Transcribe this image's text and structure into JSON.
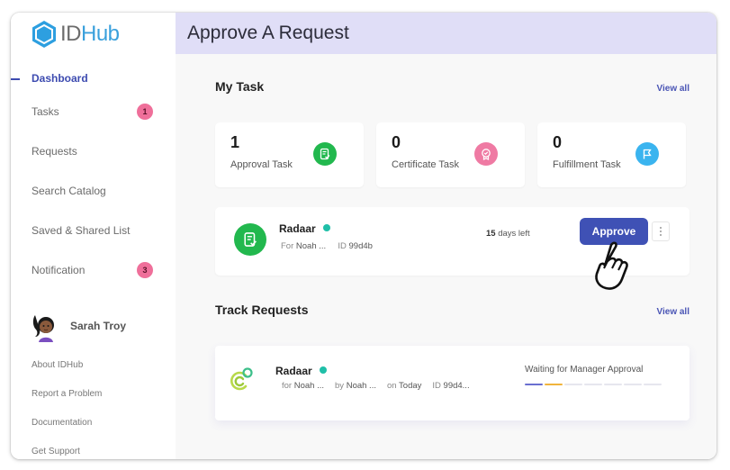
{
  "app": {
    "logo_prefix": "ID",
    "logo_suffix": "Hub"
  },
  "sidebar": {
    "items": [
      {
        "label": "Dashboard",
        "active": true
      },
      {
        "label": "Tasks",
        "badge": "1"
      },
      {
        "label": "Requests"
      },
      {
        "label": "Search Catalog"
      },
      {
        "label": "Saved & Shared List"
      },
      {
        "label": "Notification",
        "badge": "3"
      }
    ],
    "user": {
      "name": "Sarah Troy"
    },
    "footer_links": [
      "About IDHub",
      "Report a Problem",
      "Documentation",
      "Get Support"
    ]
  },
  "header": {
    "title": "Approve A Request"
  },
  "my_task": {
    "title": "My Task",
    "view_all": "View all",
    "stats": [
      {
        "count": "1",
        "label": "Approval Task",
        "icon": "approval-doc-icon",
        "color": "#22b84e"
      },
      {
        "count": "0",
        "label": "Certificate Task",
        "icon": "certificate-badge-icon",
        "color": "#ef7aa3"
      },
      {
        "count": "0",
        "label": "Fulfillment Task",
        "icon": "flag-icon",
        "color": "#3ab4ef"
      }
    ],
    "task": {
      "name": "Radaar",
      "for_label": "For",
      "for_value": "Noah ...",
      "id_label": "ID",
      "id_value": "99d4b",
      "days_count": "15",
      "days_label": "days left",
      "approve_label": "Approve"
    }
  },
  "track_requests": {
    "title": "Track Requests",
    "view_all": "View all",
    "request": {
      "name": "Radaar",
      "for_label": "for",
      "for_value": "Noah ...",
      "by_label": "by",
      "by_value": "Noah ...",
      "on_label": "on",
      "on_value": "Today",
      "id_label": "ID",
      "id_value": "99d4...",
      "status": "Waiting for Manager Approval",
      "progress": {
        "total_steps": 7,
        "completed_steps": 2,
        "step_colors": [
          "#6a6fd0",
          "#f0b43c"
        ]
      }
    }
  },
  "colors": {
    "accent": "#3f51b5",
    "header_bg": "#e0def7",
    "badge": "#ef6f9a",
    "status_dot": "#1fbfa8"
  }
}
